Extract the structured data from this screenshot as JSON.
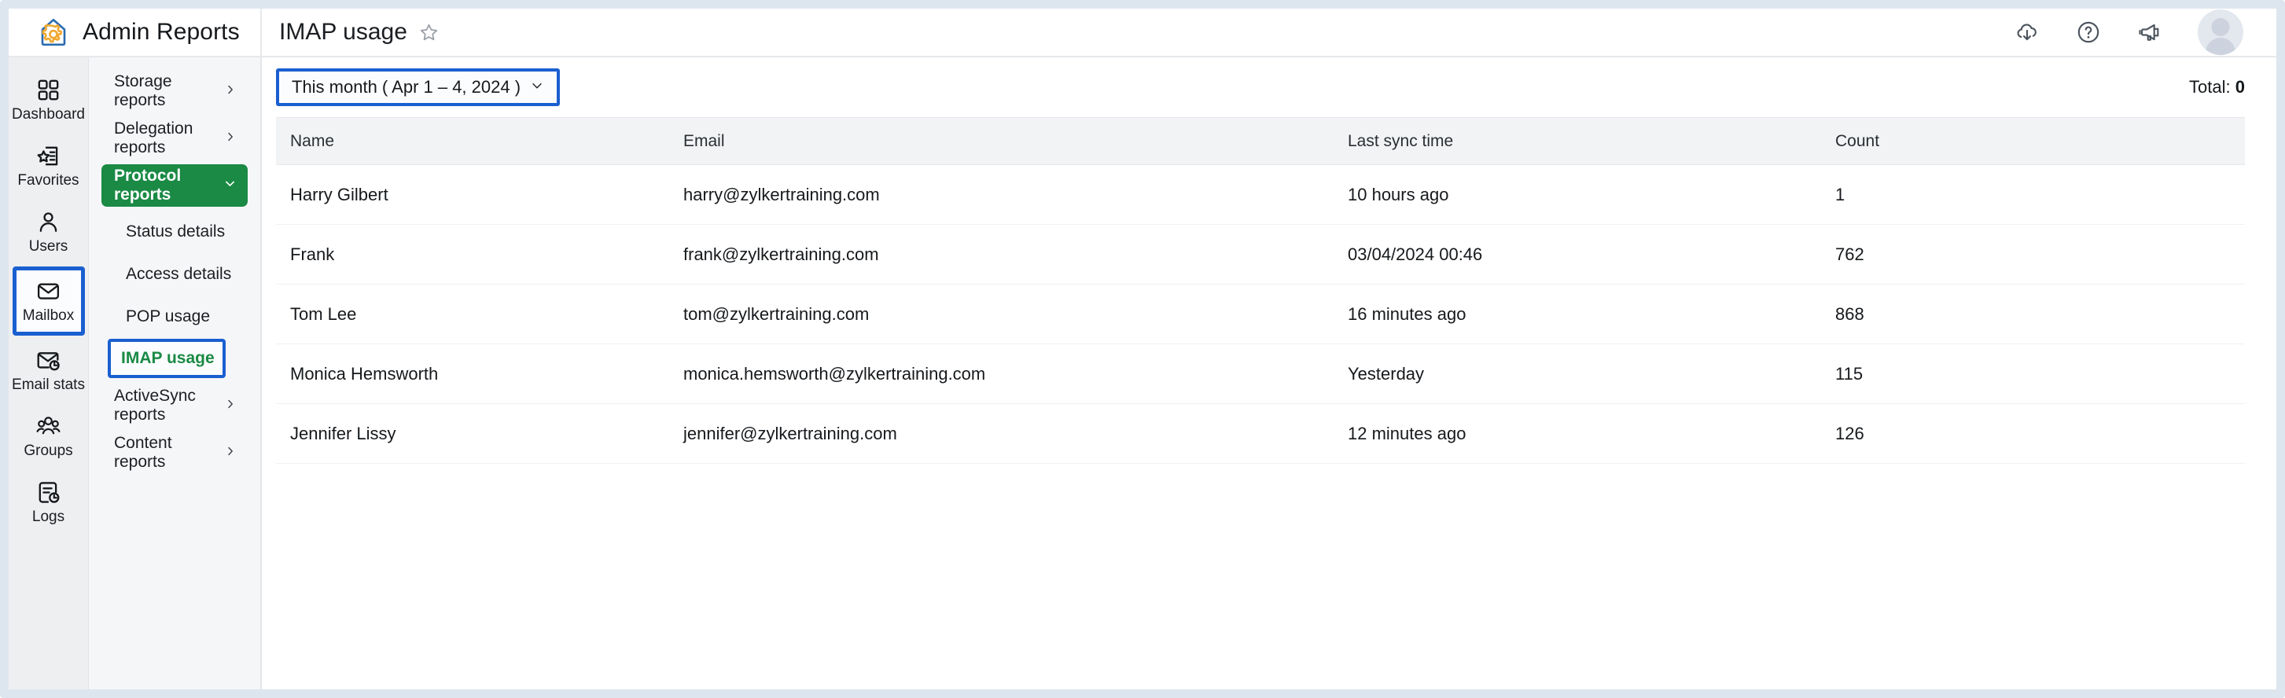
{
  "app": {
    "brand_title": "Admin Reports",
    "logo_icon": "house-gear-logo"
  },
  "header": {
    "page_title": "IMAP usage",
    "favorite_icon": "star-outline-icon",
    "actions": [
      {
        "name": "cloud-download-icon",
        "label": "Download"
      },
      {
        "name": "help-icon",
        "label": "Help"
      },
      {
        "name": "announcement-icon",
        "label": "Announcements"
      }
    ],
    "avatar": "user-avatar"
  },
  "rail": {
    "items": [
      {
        "label": "Dashboard",
        "icon": "grid-icon",
        "selected": false
      },
      {
        "label": "Favorites",
        "icon": "star-doc-icon",
        "selected": false
      },
      {
        "label": "Users",
        "icon": "user-icon",
        "selected": false
      },
      {
        "label": "Mailbox",
        "icon": "envelope-icon",
        "selected": true
      },
      {
        "label": "Email stats",
        "icon": "envelope-chart-icon",
        "selected": false
      },
      {
        "label": "Groups",
        "icon": "groups-icon",
        "selected": false
      },
      {
        "label": "Logs",
        "icon": "log-clock-icon",
        "selected": false
      }
    ]
  },
  "subnav": {
    "items": [
      {
        "label": "Storage reports",
        "type": "group",
        "expanded": false,
        "active": false
      },
      {
        "label": "Delegation reports",
        "type": "group",
        "expanded": false,
        "active": false
      },
      {
        "label": "Protocol reports",
        "type": "group",
        "expanded": true,
        "active": true
      },
      {
        "label": "Status details",
        "type": "child",
        "current": false
      },
      {
        "label": "Access details",
        "type": "child",
        "current": false
      },
      {
        "label": "POP usage",
        "type": "child",
        "current": false
      },
      {
        "label": "IMAP usage",
        "type": "child",
        "current": true
      },
      {
        "label": "ActiveSync reports",
        "type": "group",
        "expanded": false,
        "active": false
      },
      {
        "label": "Content reports",
        "type": "group",
        "expanded": false,
        "active": false
      }
    ]
  },
  "toolbar": {
    "date_filter_label": "This month ( Apr 1 – 4, 2024 )",
    "date_filter_caret": "chevron-down-icon",
    "total_label": "Total:",
    "total_value": "0"
  },
  "table": {
    "columns": [
      "Name",
      "Email",
      "Last sync time",
      "Count"
    ],
    "rows": [
      {
        "name": "Harry Gilbert",
        "email": "harry@zylkertraining.com",
        "last_sync": "10 hours ago",
        "count": "1"
      },
      {
        "name": "Frank",
        "email": "frank@zylkertraining.com",
        "last_sync": "03/04/2024 00:46",
        "count": "762"
      },
      {
        "name": "Tom Lee",
        "email": "tom@zylkertraining.com",
        "last_sync": "16 minutes ago",
        "count": "868"
      },
      {
        "name": "Monica Hemsworth",
        "email": "monica.hemsworth@zylkertraining.com",
        "last_sync": "Yesterday",
        "count": "115"
      },
      {
        "name": "Jennifer Lissy",
        "email": "jennifer@zylkertraining.com",
        "last_sync": "12 minutes ago",
        "count": "126"
      }
    ]
  },
  "colors": {
    "accent_green": "#1a8a45",
    "highlight_blue": "#1a5fd0",
    "logo_blue": "#2b6cb0",
    "logo_orange": "#f0a830",
    "rail_bg": "#eeeff1",
    "subnav_bg": "#f5f6f8",
    "header_row_bg": "#f1f3f5"
  }
}
